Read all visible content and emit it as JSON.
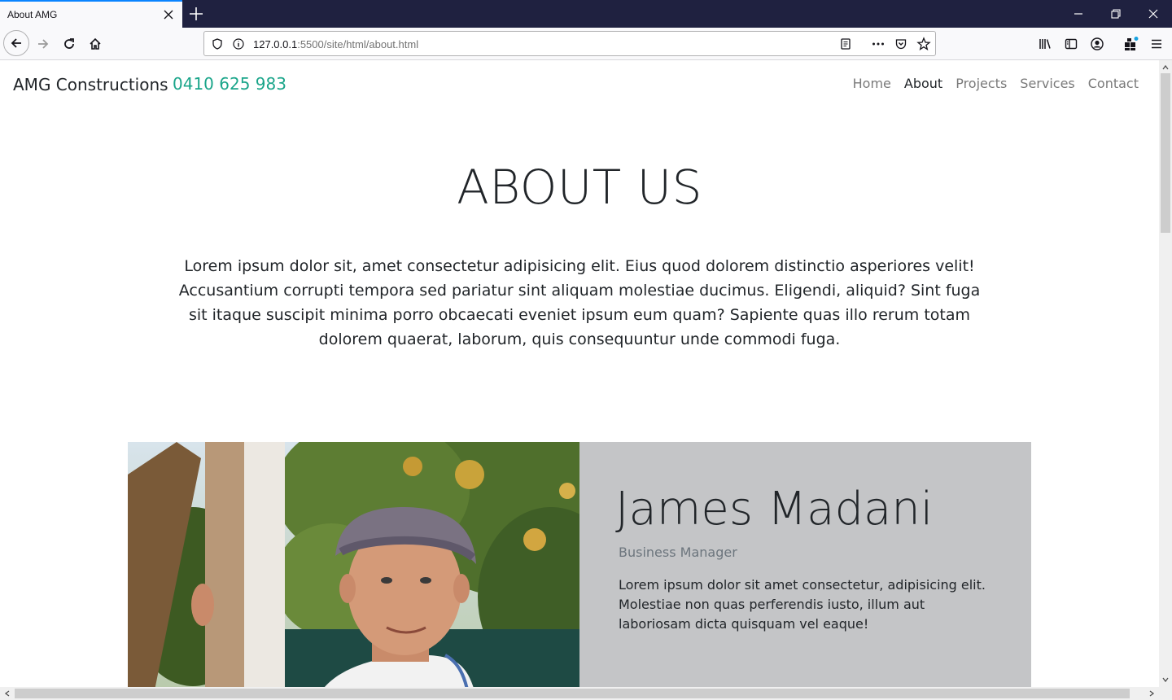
{
  "browser": {
    "tab_title": "About AMG",
    "url_host": "127.0.0.1",
    "url_path": ":5500/site/html/about.html"
  },
  "site": {
    "brand": "AMG Constructions",
    "phone": "0410 625 983",
    "nav": [
      {
        "label": "Home",
        "active": false
      },
      {
        "label": "About",
        "active": true
      },
      {
        "label": "Projects",
        "active": false
      },
      {
        "label": "Services",
        "active": false
      },
      {
        "label": "Contact",
        "active": false
      }
    ]
  },
  "hero": {
    "title": "ABOUT US",
    "text": "Lorem ipsum dolor sit, amet consectetur adipisicing elit. Eius quod dolorem distinctio asperiores velit! Accusantium corrupti tempora sed pariatur sint aliquam molestiae ducimus. Eligendi, aliquid? Sint fuga sit itaque suscipit minima porro obcaecati eveniet ipsum eum quam? Sapiente quas illo rerum totam dolorem quaerat, laborum, quis consequuntur unde commodi fuga."
  },
  "profile": {
    "name": "James Madani",
    "role": "Business Manager",
    "bio": "Lorem ipsum dolor sit amet consectetur, adipisicing elit. Molestiae non quas perferendis iusto, illum aut laboriosam dicta quisquam vel eaque!"
  },
  "colors": {
    "phone": "#1aa58a",
    "card_bg": "#c4c5c7",
    "tabbar_bg": "#1f2140"
  }
}
